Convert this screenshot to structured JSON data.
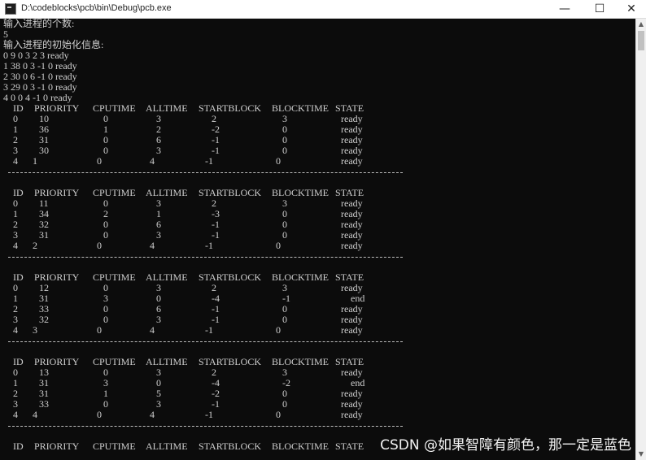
{
  "window": {
    "title": "D:\\codeblocks\\pcb\\bin\\Debug\\pcb.exe",
    "minimize_glyph": "—",
    "maximize_glyph": "☐",
    "close_glyph": "✕"
  },
  "console": {
    "prompt_count": "输入进程的个数:",
    "count_value": "5",
    "prompt_init": "输入进程的初始化信息:",
    "init_lines": [
      "0 9 0 3 2 3 ready",
      "1 38 0 3 -1 0 ready",
      "2 30 0 6 -1 0 ready",
      "3 29 0 3 -1 0 ready",
      "4 0 0 4 -1 0 ready"
    ],
    "headers": [
      "ID",
      "PRIORITY",
      "CPUTIME",
      "ALLTIME",
      "STARTBLOCK",
      "BLOCKTIME",
      "STATE"
    ],
    "separator": "--------------------------------------------------------------------------------",
    "tables": [
      {
        "rows": [
          [
            "0",
            "10",
            "0",
            "3",
            "2",
            "3",
            "ready"
          ],
          [
            "1",
            "36",
            "1",
            "2",
            "-2",
            "0",
            "ready"
          ],
          [
            "2",
            "31",
            "0",
            "6",
            "-1",
            "0",
            "ready"
          ],
          [
            "3",
            "30",
            "0",
            "3",
            "-1",
            "0",
            "ready"
          ],
          [
            "4",
            "1",
            "0",
            "4",
            "-1",
            "0",
            "ready"
          ]
        ]
      },
      {
        "rows": [
          [
            "0",
            "11",
            "0",
            "3",
            "2",
            "3",
            "ready"
          ],
          [
            "1",
            "34",
            "2",
            "1",
            "-3",
            "0",
            "ready"
          ],
          [
            "2",
            "32",
            "0",
            "6",
            "-1",
            "0",
            "ready"
          ],
          [
            "3",
            "31",
            "0",
            "3",
            "-1",
            "0",
            "ready"
          ],
          [
            "4",
            "2",
            "0",
            "4",
            "-1",
            "0",
            "ready"
          ]
        ]
      },
      {
        "rows": [
          [
            "0",
            "12",
            "0",
            "3",
            "2",
            "3",
            "ready"
          ],
          [
            "1",
            "31",
            "3",
            "0",
            "-4",
            "-1",
            "end"
          ],
          [
            "2",
            "33",
            "0",
            "6",
            "-1",
            "0",
            "ready"
          ],
          [
            "3",
            "32",
            "0",
            "3",
            "-1",
            "0",
            "ready"
          ],
          [
            "4",
            "3",
            "0",
            "4",
            "-1",
            "0",
            "ready"
          ]
        ]
      },
      {
        "rows": [
          [
            "0",
            "13",
            "0",
            "3",
            "2",
            "3",
            "ready"
          ],
          [
            "1",
            "31",
            "3",
            "0",
            "-4",
            "-2",
            "end"
          ],
          [
            "2",
            "31",
            "1",
            "5",
            "-2",
            "0",
            "ready"
          ],
          [
            "3",
            "33",
            "0",
            "3",
            "-1",
            "0",
            "ready"
          ],
          [
            "4",
            "4",
            "0",
            "4",
            "-1",
            "0",
            "ready"
          ]
        ]
      }
    ]
  },
  "watermark": "CSDN @如果智障有颜色，那一定是蓝色"
}
